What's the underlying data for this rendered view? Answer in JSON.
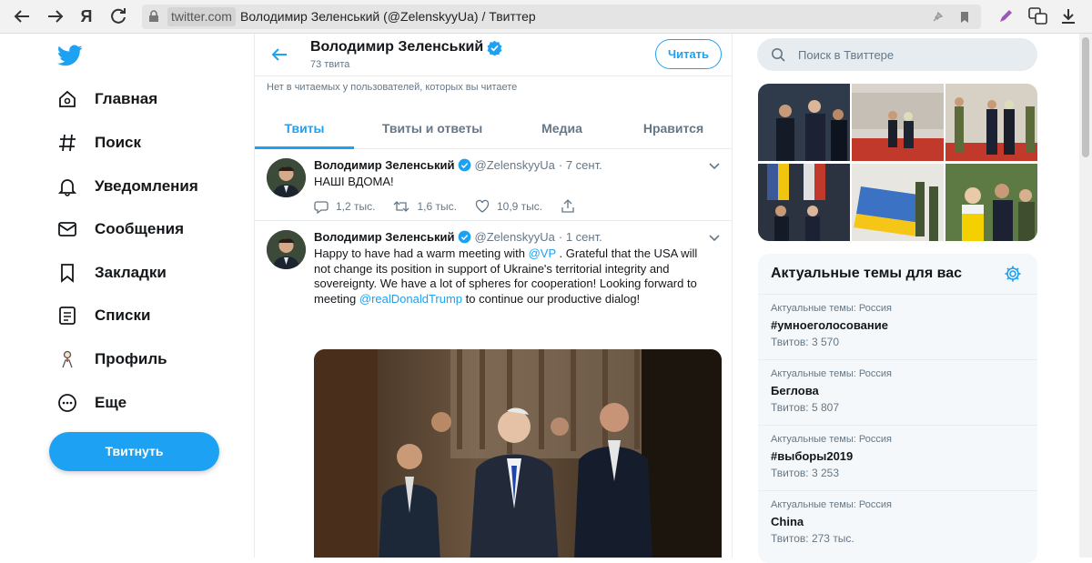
{
  "browser": {
    "host": "twitter.com",
    "page_title": "Володимир Зеленський (@ZelenskyyUa) / Твиттер",
    "yandex_label": "Я"
  },
  "nav": {
    "items": [
      {
        "label": "Главная",
        "icon": "home-icon"
      },
      {
        "label": "Поиск",
        "icon": "hashtag-icon"
      },
      {
        "label": "Уведомления",
        "icon": "bell-icon"
      },
      {
        "label": "Сообщения",
        "icon": "envelope-icon"
      },
      {
        "label": "Закладки",
        "icon": "bookmark-icon"
      },
      {
        "label": "Списки",
        "icon": "list-icon"
      },
      {
        "label": "Профиль",
        "icon": "profile-icon"
      },
      {
        "label": "Еще",
        "icon": "more-icon"
      }
    ],
    "tweet_button": "Твитнуть"
  },
  "profile_header": {
    "name": "Володимир Зеленський",
    "tweet_count": "73 твита",
    "follow_button": "Читать",
    "notice": "Нет в читаемых у пользователей, которых вы читаете"
  },
  "tabs": [
    {
      "label": "Твиты",
      "active": true
    },
    {
      "label": "Твиты и ответы",
      "active": false
    },
    {
      "label": "Медиа",
      "active": false
    },
    {
      "label": "Нравится",
      "active": false
    }
  ],
  "tweets": [
    {
      "name": "Володимир Зеленський",
      "handle": "@ZelenskyyUa",
      "date": "· 7 сент.",
      "text": "НАШІ ВДОМА!",
      "replies": "1,2 тыс.",
      "retweets": "1,6 тыс.",
      "likes": "10,9 тыс."
    },
    {
      "name": "Володимир Зеленський",
      "handle": "@ZelenskyyUa",
      "date": "· 1 сент.",
      "text_part1": "Happy to have had a warm meeting with ",
      "mention1": "@VP",
      "text_part2": " . Grateful that the USA will not change its position in support of Ukraine's territorial integrity and sovereignty. We have a lot of spheres for cooperation! Looking forward to meeting ",
      "mention2": "@realDonaldTrump",
      "text_part3": " to continue our productive dialog!"
    }
  ],
  "search": {
    "placeholder": "Поиск в Твиттере"
  },
  "trends": {
    "title": "Актуальные темы для вас",
    "items": [
      {
        "context": "Актуальные темы: Россия",
        "name": "#умноеголосование",
        "count": "Твитов: 3 570"
      },
      {
        "context": "Актуальные темы: Россия",
        "name": "Беглова",
        "count": "Твитов: 5 807"
      },
      {
        "context": "Актуальные темы: Россия",
        "name": "#выборы2019",
        "count": "Твитов: 3 253"
      },
      {
        "context": "Актуальные темы: Россия",
        "name": "China",
        "count": "Твитов: 273 тыс."
      }
    ]
  },
  "colors": {
    "accent": "#1da1f2",
    "text": "#14171a",
    "muted": "#657786"
  }
}
